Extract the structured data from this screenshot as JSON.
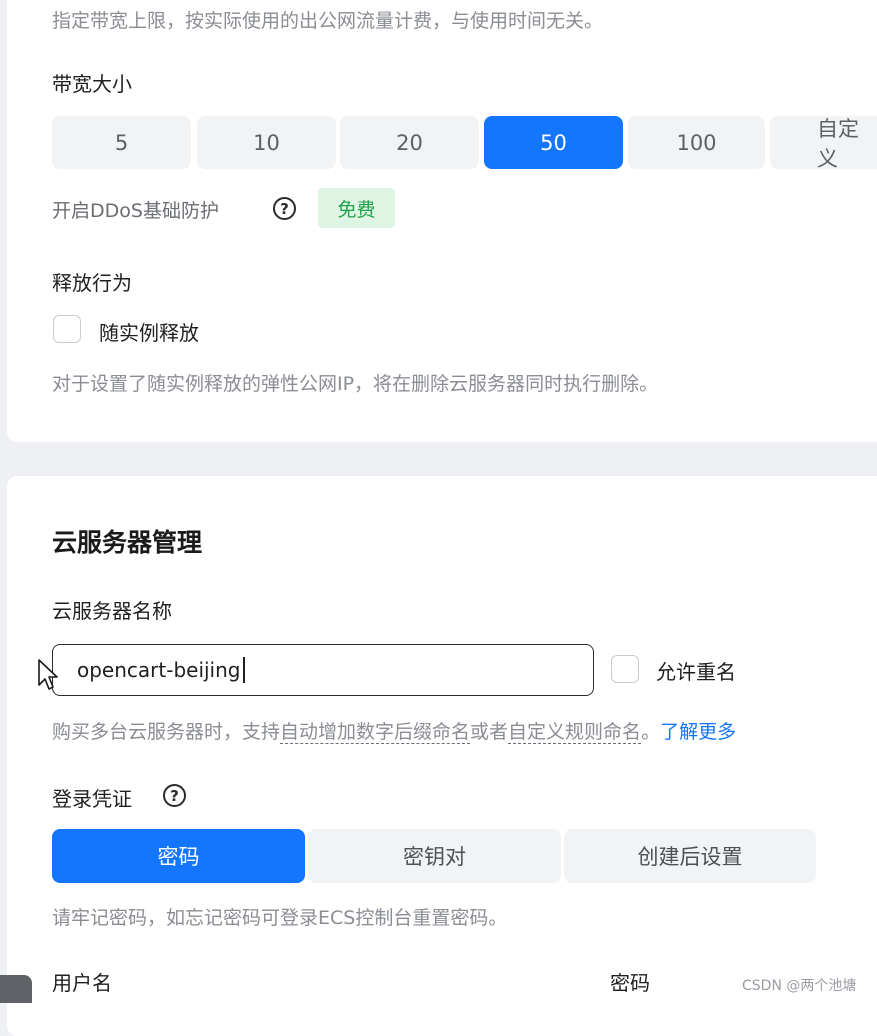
{
  "bandwidth": {
    "description": "指定带宽上限，按实际使用的出公网流量计费，与使用时间无关。",
    "size_label": "带宽大小",
    "options": [
      "5",
      "10",
      "20",
      "50",
      "100",
      "自定义"
    ],
    "selected": "50",
    "ddos_label": "开启DDoS基础防护",
    "ddos_badge": "免费",
    "release_label": "释放行为",
    "release_checkbox_label": "随实例释放",
    "release_note": "对于设置了随实例释放的弹性公网IP，将在删除云服务器同时执行删除。"
  },
  "server_management": {
    "section_title": "云服务器管理",
    "name_label": "云服务器名称",
    "name_value": "opencart-beijing",
    "allow_duplicate_label": "允许重名",
    "hint_prefix": "购买多台云服务器时，支持",
    "hint_link1": "自动增加数字后缀命名",
    "hint_or": "或者",
    "hint_link2": "自定义规则命名",
    "hint_period": "。",
    "learn_more": "了解更多",
    "credential_label": "登录凭证",
    "credential_options": [
      "密码",
      "密钥对",
      "创建后设置"
    ],
    "credential_selected": "密码",
    "credential_note": "请牢记密码，如忘记密码可登录ECS控制台重置密码。",
    "username_label": "用户名",
    "password_label": "密码"
  },
  "watermark": "CSDN @两个池塘",
  "colors": {
    "accent": "#1476ff",
    "free_badge_bg": "#dff5e4",
    "free_badge_text": "#22a14a",
    "link": "#1476ff"
  },
  "icons": [
    "help-icon",
    "mouse-cursor-icon"
  ]
}
